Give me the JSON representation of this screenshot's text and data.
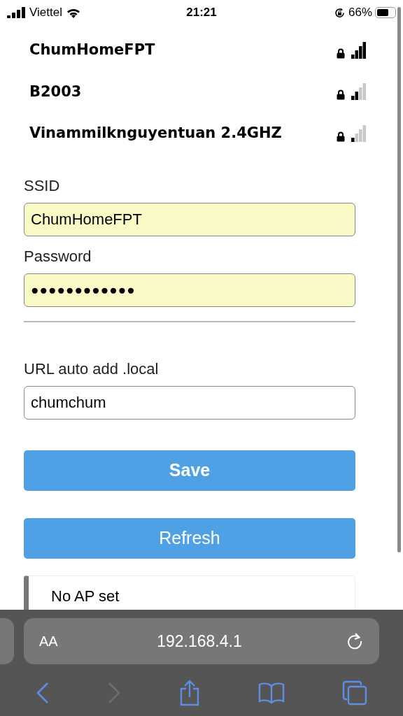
{
  "status_bar": {
    "carrier": "Viettel",
    "time": "21:21",
    "battery": "66%"
  },
  "networks": [
    {
      "ssid": "ChumHomeFPT",
      "locked": true,
      "kind": "strong"
    },
    {
      "ssid": "B2003",
      "locked": true,
      "kind": "medium"
    },
    {
      "ssid": "Vinammilknguyentuan 2.4GHZ",
      "locked": true,
      "kind": "weak"
    }
  ],
  "form": {
    "ssid_label": "SSID",
    "ssid_value": "ChumHomeFPT",
    "password_label": "Password",
    "password_value": "●●●●●●●●●●●●",
    "url_label": "URL auto add .local",
    "url_value": "chumchum"
  },
  "buttons": [
    {
      "label": "Save",
      "kind": "primary"
    },
    {
      "label": "Refresh",
      "kind": "secondary"
    }
  ],
  "message": "No AP set",
  "browser": {
    "text_size": "AA",
    "address": "192.168.4.1",
    "forward_disabled": true
  }
}
